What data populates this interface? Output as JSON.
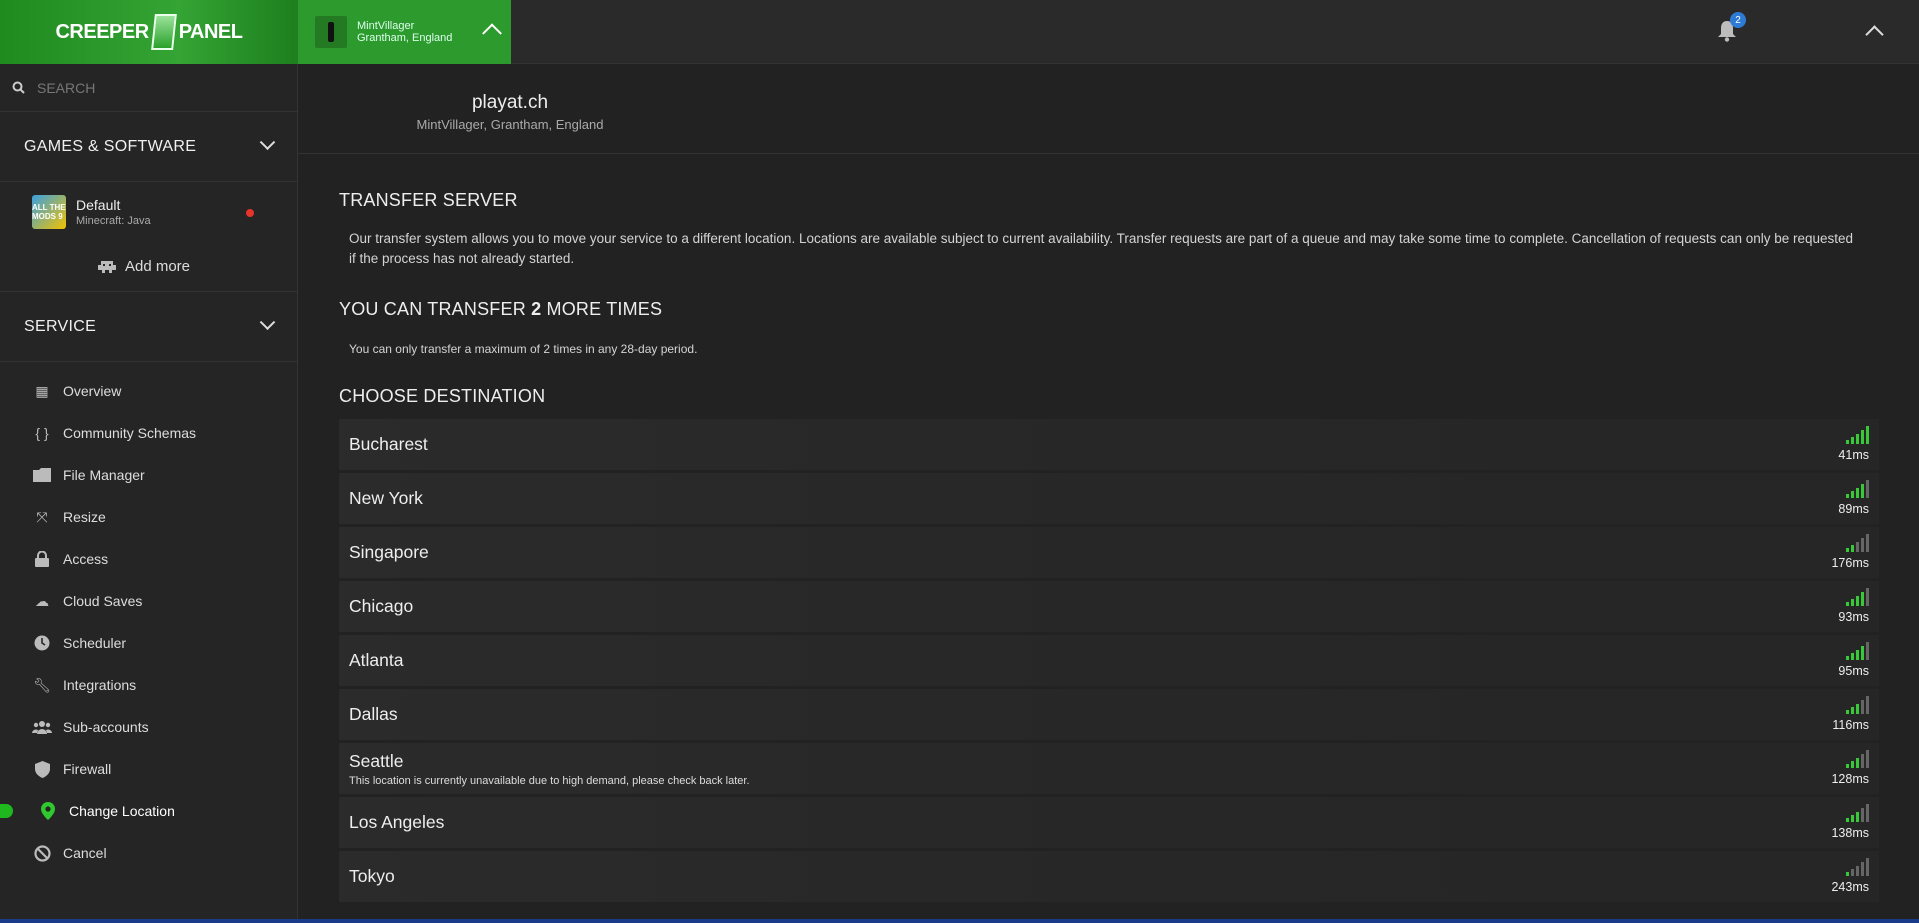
{
  "topbar": {
    "logo_left": "CREEPER",
    "logo_right": "PANEL",
    "server_name": "MintVillager",
    "server_location": "Grantham, England",
    "notification_count": "2"
  },
  "sidebar": {
    "search_placeholder": "SEARCH",
    "games_heading": "GAMES & SOFTWARE",
    "game": {
      "name": "Default",
      "sub": "Minecraft: Java",
      "thumb_text": "ALL THE MODS 9"
    },
    "add_more": "Add more",
    "service_heading": "SERVICE",
    "nav": [
      {
        "label": "Overview",
        "icon": "grid-icon"
      },
      {
        "label": "Community Schemas",
        "icon": "braces-icon"
      },
      {
        "label": "File Manager",
        "icon": "folder-icon"
      },
      {
        "label": "Resize",
        "icon": "resize-icon"
      },
      {
        "label": "Access",
        "icon": "lock-icon"
      },
      {
        "label": "Cloud Saves",
        "icon": "cloud-icon"
      },
      {
        "label": "Scheduler",
        "icon": "clock-icon"
      },
      {
        "label": "Integrations",
        "icon": "wrench-icon"
      },
      {
        "label": "Sub-accounts",
        "icon": "users-icon"
      },
      {
        "label": "Firewall",
        "icon": "shield-icon"
      },
      {
        "label": "Change Location",
        "icon": "map-pin-icon",
        "active": true
      },
      {
        "label": "Cancel",
        "icon": "ban-icon"
      }
    ]
  },
  "main": {
    "server_title": "playat.ch",
    "server_subtitle": "MintVillager, Grantham, England",
    "transfer_title": "TRANSFER SERVER",
    "transfer_desc": "Our transfer system allows you to move your service to a different location. Locations are available subject to current availability. Transfer requests are part of a queue and may take some time to complete. Cancellation of requests can only be requested if the process has not already started.",
    "remaining_prefix": "YOU CAN TRANSFER ",
    "remaining_count": "2",
    "remaining_suffix": " MORE TIMES",
    "limit_note": "You can only transfer a maximum of 2 times in any 28-day period.",
    "choose_title": "CHOOSE DESTINATION",
    "destinations": [
      {
        "name": "Bucharest",
        "ping": "41ms",
        "bars": 5,
        "note": ""
      },
      {
        "name": "New York",
        "ping": "89ms",
        "bars": 4,
        "note": ""
      },
      {
        "name": "Singapore",
        "ping": "176ms",
        "bars": 2,
        "note": ""
      },
      {
        "name": "Chicago",
        "ping": "93ms",
        "bars": 4,
        "note": ""
      },
      {
        "name": "Atlanta",
        "ping": "95ms",
        "bars": 4,
        "note": ""
      },
      {
        "name": "Dallas",
        "ping": "116ms",
        "bars": 3,
        "note": ""
      },
      {
        "name": "Seattle",
        "ping": "128ms",
        "bars": 3,
        "note": "This location is currently unavailable due to high demand, please check back later."
      },
      {
        "name": "Los Angeles",
        "ping": "138ms",
        "bars": 3,
        "note": ""
      },
      {
        "name": "Tokyo",
        "ping": "243ms",
        "bars": 1,
        "note": ""
      }
    ]
  },
  "colors": {
    "accent": "#2c9a2c",
    "signal_on": "#38c838",
    "signal_off": "#666666",
    "alert": "#e5342b"
  }
}
